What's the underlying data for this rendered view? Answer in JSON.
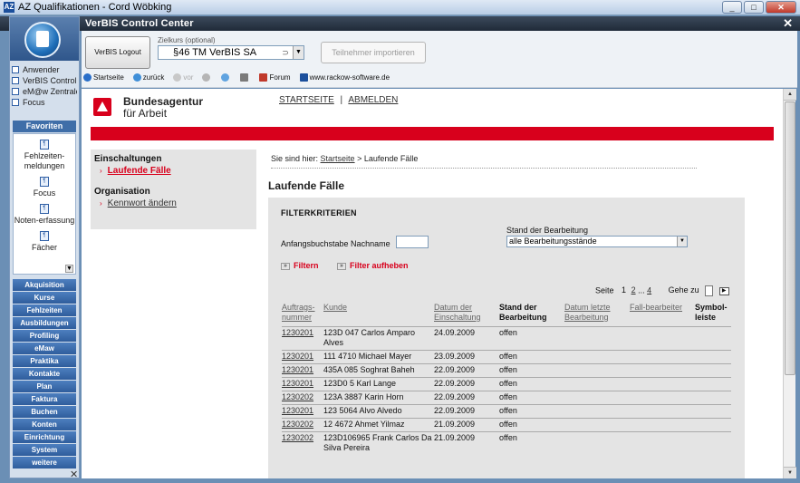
{
  "window": {
    "title": "AZ Qualifikationen - Cord Wöbking",
    "app_icon": "AZ"
  },
  "header": {
    "title": "VerBIS Control Center"
  },
  "sidebar": {
    "apps": [
      "Anwender",
      "VerBIS Control",
      "eM@w Zentrale",
      "Focus"
    ],
    "favorites_label": "Favoriten",
    "favorites": [
      "Fehlzeiten-meldungen",
      "Focus",
      "Noten-erfassung",
      "Fächer"
    ],
    "nav": [
      "Akquisition",
      "Kurse",
      "Fehlzeiten",
      "Ausbildungen",
      "Profiling",
      "eMaw",
      "Praktika",
      "Kontakte",
      "Plan",
      "Faktura",
      "Buchen",
      "Konten",
      "Einrichtung",
      "System",
      "weitere"
    ]
  },
  "toolbar": {
    "logout_label": "VerBIS Logout",
    "zielkurs_label": "Zielkurs (optional)",
    "zielkurs_value": "§46 TM VerBIS SA",
    "import_label": "Teilnehmer importieren",
    "links": {
      "startseite": "Startseite",
      "zurueck": "zurück",
      "vor": "vor",
      "forum": "Forum",
      "website": "www.rackow-software.de"
    }
  },
  "page": {
    "brand_line1": "Bundesagentur",
    "brand_line2": "für Arbeit",
    "topnav_startseite": "STARTSEITE",
    "topnav_sep": "|",
    "topnav_abmelden": "ABMELDEN",
    "leftnav": {
      "einschaltungen": "Einschaltungen",
      "laufende_faelle": "Laufende Fälle",
      "organisation": "Organisation",
      "kennwort": "Kennwort ändern"
    },
    "breadcrumb_prefix": "Sie sind hier:",
    "breadcrumb_link": "Startseite",
    "breadcrumb_current": "> Laufende Fälle",
    "heading": "Laufende Fälle",
    "filter": {
      "title": "FILTERKRITERIEN",
      "name_label": "Anfangsbuchstabe Nachname",
      "name_value": "",
      "stand_label": "Stand der Bearbeitung",
      "stand_value": "alle Bearbeitungsstände",
      "filtern": "Filtern",
      "aufheben": "Filter aufheben"
    },
    "pager": {
      "label": "Seite",
      "current": "1",
      "p2": "2",
      "ellipsis": "...",
      "p4": "4",
      "goto_label": "Gehe zu"
    },
    "table": {
      "headers": [
        "Auftrags-nummer",
        "Kunde",
        "Datum der Einschaltung",
        "Stand der Bearbeitung",
        "Datum letzte Bearbeitung",
        "Fall-bearbeiter",
        "Symbol-leiste"
      ],
      "rows": [
        [
          "1230201",
          "123D 047 Carlos Amparo Alves",
          "24.09.2009",
          "offen"
        ],
        [
          "1230201",
          "111 4710 Michael Mayer",
          "23.09.2009",
          "offen"
        ],
        [
          "1230201",
          "435A 085 Soghrat Baheh",
          "22.09.2009",
          "offen"
        ],
        [
          "1230201",
          "123D0 5 Karl Lange",
          "22.09.2009",
          "offen"
        ],
        [
          "1230202",
          "123A 3887 Karin Horn",
          "22.09.2009",
          "offen"
        ],
        [
          "1230201",
          "123 5064 Alvo Alvedo",
          "22.09.2009",
          "offen"
        ],
        [
          "1230202",
          "12 4672 Ahmet Yilmaz",
          "21.09.2009",
          "offen"
        ],
        [
          "1230202",
          "123D106965 Frank Carlos Da Silva Pereira",
          "21.09.2009",
          "offen"
        ]
      ]
    }
  }
}
